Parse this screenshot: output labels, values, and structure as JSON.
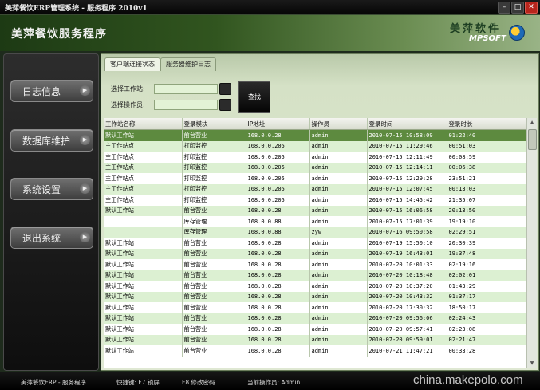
{
  "window": {
    "title": "美萍餐饮ERP管理系统 - 服务程序 2010v1",
    "minimize_icon": "minus-icon",
    "maximize_icon": "square-icon",
    "close_icon": "x-icon"
  },
  "header": {
    "app_title": "美萍餐饮服务程序",
    "logo_cn": "美萍软件",
    "logo_en": "MPSOFT"
  },
  "sidebar": {
    "items": [
      {
        "label": "日志信息"
      },
      {
        "label": "数据库维护"
      },
      {
        "label": "系统设置"
      },
      {
        "label": "退出系统"
      }
    ],
    "arrow_icon": "circle-arrow-right-icon"
  },
  "tabs": [
    {
      "label": "客户端连接状态",
      "active": true
    },
    {
      "label": "服务器维护日志",
      "active": false
    }
  ],
  "filters": {
    "workstation_label": "选择工作站:",
    "operator_label": "选择操作员:",
    "workstation_value": "",
    "operator_value": "",
    "query_button": "查找"
  },
  "table": {
    "columns": [
      "工作站名称",
      "登录模块",
      "IP地址",
      "操作员",
      "登录时间",
      "登录时长"
    ],
    "rows": [
      [
        "默认工作站",
        "前台营业",
        "168.0.0.28",
        "admin",
        "2010-07-15 10:58:09",
        "01:22:40"
      ],
      [
        "主工作站点",
        "打印监控",
        "168.0.0.205",
        "admin",
        "2010-07-15 11:29:46",
        "00:51:03"
      ],
      [
        "主工作站点",
        "打印监控",
        "168.0.0.205",
        "admin",
        "2010-07-15 12:11:49",
        "00:08:59"
      ],
      [
        "主工作站点",
        "打印监控",
        "168.0.0.205",
        "admin",
        "2010-07-15 12:14:11",
        "00:06:38"
      ],
      [
        "主工作站点",
        "打印监控",
        "168.0.0.205",
        "admin",
        "2010-07-15 12:29:28",
        "23:51:21"
      ],
      [
        "主工作站点",
        "打印监控",
        "168.0.0.205",
        "admin",
        "2010-07-15 12:07:45",
        "00:13:03"
      ],
      [
        "主工作站点",
        "打印监控",
        "168.0.0.205",
        "admin",
        "2010-07-15 14:45:42",
        "21:35:07"
      ],
      [
        "默认工作站",
        "前台营业",
        "168.0.0.28",
        "admin",
        "2010-07-15 16:06:58",
        "20:13:50"
      ],
      [
        "",
        "库存管理",
        "168.0.0.88",
        "admin",
        "2010-07-15 17:01:39",
        "19:19:10"
      ],
      [
        "",
        "库存管理",
        "168.0.0.88",
        "zyw",
        "2010-07-16 09:50:58",
        "02:29:51"
      ],
      [
        "默认工作站",
        "前台营业",
        "168.0.0.28",
        "admin",
        "2010-07-19 15:50:10",
        "20:30:39"
      ],
      [
        "默认工作站",
        "前台营业",
        "168.0.0.28",
        "admin",
        "2010-07-19 16:43:01",
        "19:37:48"
      ],
      [
        "默认工作站",
        "前台营业",
        "168.0.0.28",
        "admin",
        "2010-07-20 10:01:33",
        "02:19:16"
      ],
      [
        "默认工作站",
        "前台营业",
        "168.0.0.28",
        "admin",
        "2010-07-20 10:18:48",
        "02:02:01"
      ],
      [
        "默认工作站",
        "前台营业",
        "168.0.0.28",
        "admin",
        "2010-07-20 10:37:20",
        "01:43:29"
      ],
      [
        "默认工作站",
        "前台营业",
        "168.0.0.28",
        "admin",
        "2010-07-20 10:43:32",
        "01:37:17"
      ],
      [
        "默认工作站",
        "前台营业",
        "168.0.0.28",
        "admin",
        "2010-07-20 17:30:32",
        "18:50:17"
      ],
      [
        "默认工作站",
        "前台营业",
        "168.0.0.28",
        "admin",
        "2010-07-20 09:56:06",
        "02:24:43"
      ],
      [
        "默认工作站",
        "前台营业",
        "168.0.0.28",
        "admin",
        "2010-07-20 09:57:41",
        "02:23:08"
      ],
      [
        "默认工作站",
        "前台营业",
        "168.0.0.28",
        "admin",
        "2010-07-20 09:59:01",
        "02:21:47"
      ],
      [
        "默认工作站",
        "前台营业",
        "168.0.0.28",
        "admin",
        "2010-07-21 11:47:21",
        "00:33:28"
      ]
    ],
    "selected_row": 0
  },
  "statusbar": {
    "app": "美萍餐饮ERP - 服务程序",
    "hotkey1": "快捷键: F7 锁屏",
    "hotkey2": "F8 修改密码",
    "operator": "当前操作员: Admin"
  },
  "watermark": "china.makepolo.com",
  "colors": {
    "header_dark": "#1d3a14",
    "header_light": "#99b386",
    "row_alt": "#dcf0d2",
    "row_selected": "#5d8a3f",
    "close_button": "#b8251d"
  }
}
